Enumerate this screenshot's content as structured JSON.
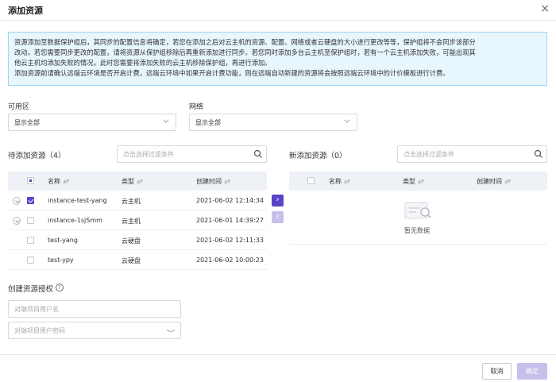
{
  "dialog": {
    "title": "添加资源",
    "close_glyph": "×"
  },
  "notice": {
    "lines": [
      "资源添加至数据保护组后，其同步的配置信息将确定，若您在添加之后对云主机的资源、配置、网络或者云硬盘的大小进行更改等等，保护组将不会同步该部分",
      "改动。若您需要同步更改的配置，请将资源从保护组移除后再重新添加进行同步。若您同时添加多台云主机至保护组时，若有一个云主机添加失败，可能出现其",
      "他云主机均添加失败的情况，此时您需要将添加失败的云主机移除保护组，再进行添加。",
      "添加资源前请确认远端云环境是否开启计费，远端云环境中如果开启计费功能，则在远端自动新建的资源将会按照远端云环境中的计价模板进行计费。"
    ]
  },
  "filters": {
    "zone_label": "可用区",
    "zone_value": "显示全部",
    "network_label": "网络",
    "network_value": "显示全部"
  },
  "pending": {
    "title": "待添加资源（4）",
    "search_placeholder": "点击选择过滤条件",
    "columns": [
      "名称",
      "类型",
      "创建时间"
    ],
    "rows": [
      {
        "name": "instance-test-yang",
        "type": "云主机",
        "created": "2021-06-02 12:14:34",
        "checked": true,
        "expandable": true
      },
      {
        "name": "instance-1sjSmm",
        "type": "云主机",
        "created": "2021-06-01 14:39:27",
        "checked": false,
        "expandable": true
      },
      {
        "name": "test-yang",
        "type": "云硬盘",
        "created": "2021-06-02 12:11:33",
        "checked": false,
        "expandable": false
      },
      {
        "name": "test-ypy",
        "type": "云硬盘",
        "created": "2021-06-02 10:00:23",
        "checked": false,
        "expandable": false
      }
    ]
  },
  "added": {
    "title": "新添加资源（0）",
    "search_placeholder": "点击选择过滤条件",
    "columns": [
      "名称",
      "类型",
      "创建时间"
    ],
    "empty_text": "暂无数据"
  },
  "transfer": {
    "right_glyph": "›",
    "left_glyph": "‹"
  },
  "auth": {
    "title": "创建资源授权",
    "help_glyph": "?",
    "username_placeholder": "对端项目用户名",
    "password_placeholder": "对端项目用户密码"
  },
  "footer": {
    "cancel_label": "取消",
    "ok_label": "确定"
  },
  "colors": {
    "primary": "#5b43c8",
    "primary_disabled": "#c8c0ea",
    "notice_bg": "#e8f6fe",
    "notice_border": "#9ed6f4",
    "table_header_bg": "#eef1f6"
  },
  "icons": {
    "search": "search-icon",
    "chevron": "chevron-down-icon",
    "eye": "eye-off-icon",
    "help": "question-circle-icon",
    "empty": "empty-data-icon"
  }
}
